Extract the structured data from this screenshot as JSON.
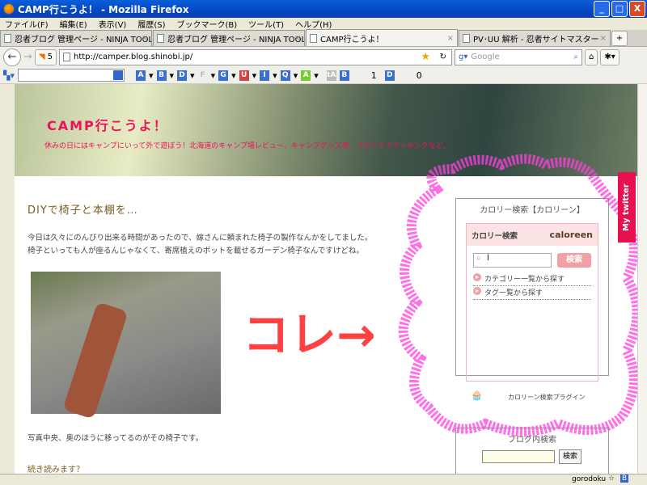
{
  "window": {
    "title": "CAMP行こうよ！ - Mozilla Firefox"
  },
  "menu": [
    "ファイル(F)",
    "編集(E)",
    "表示(V)",
    "履歴(S)",
    "ブックマーク(B)",
    "ツール(T)",
    "ヘルプ(H)"
  ],
  "tabs": [
    {
      "label": "忍者ブログ 管理ページ - NINJA TOOLS"
    },
    {
      "label": "忍者ブログ 管理ページ - NINJA TOOLS"
    },
    {
      "label": "CAMP行こうよ！",
      "active": true
    },
    {
      "label": "PV･UU 解析 - 忍者サイトマスター"
    }
  ],
  "nav": {
    "rss_count": "5",
    "url": "http://camper.blog.shinobi.jp/",
    "search_placeholder": "Google"
  },
  "toolbar2": {
    "buttons": [
      "A",
      "B",
      "D",
      "F",
      "G",
      "U",
      "I",
      "Q",
      "A"
    ],
    "counter_b": "1",
    "counter_d": "0",
    "b_label": "B",
    "d_label": "D",
    "ta_label": "tA"
  },
  "blog": {
    "title": "CAMP行こうよ！",
    "description": "休みの日にはキャンプにいって外で遊ぼう！北海道のキャンプ場レビュー、キャンプグッズ考、アウトドアクッキングなど。"
  },
  "post": {
    "title": "DIYで椅子と本棚を…",
    "lines": [
      "今日は久々にのんびり出来る時間があったので、嫁さんに頼まれた椅子の製作なんかをしてました。",
      "椅子といっても人が座るんじゃなくて、寄席植えのポットを載せるガーデン椅子なんですけどね。"
    ],
    "caption": "写真中央、奥のほうに移ってるのがその椅子です。",
    "more": "続き読みます？"
  },
  "sidebar": {
    "calorie_heading": "カロリー検索【カロリーン】",
    "widget_title": "カロリー検索",
    "logo": "caloreen",
    "input_value": "l",
    "search_button": "検索",
    "links": [
      "カテゴリー一覧から探す",
      "タグ一覧から探す"
    ],
    "plugin": "カロリーン検索プラグイン",
    "blog_search_heading": "ブログ内検索",
    "blog_search_button": "検索"
  },
  "annotation": {
    "text": "コレ→",
    "color": "#ff2020",
    "outline_color": "#ff40e0"
  },
  "twitter": "My twitter",
  "status": {
    "user": "gorodoku"
  }
}
